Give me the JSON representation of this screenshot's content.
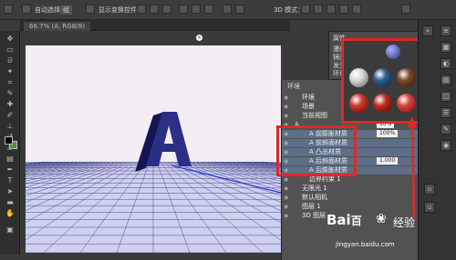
{
  "options_bar": {
    "auto_select_label": "自动选择：",
    "auto_select_value": "组",
    "transform_label": "显示变换控件",
    "mode_3d_label": "3D 模式："
  },
  "document": {
    "tab_label": "66.7% (A, RGB/8)",
    "letter": "A"
  },
  "properties_panel": {
    "tab_title": "属性",
    "rows": [
      "漫射：",
      "镜面：",
      "发光：",
      "环境："
    ]
  },
  "layers_panel": {
    "header_tab": "环境",
    "rows": [
      {
        "label": "环境",
        "indent": 1
      },
      {
        "label": "场景",
        "indent": 1
      },
      {
        "label": "当前视图",
        "indent": 1
      },
      {
        "label": "A",
        "indent": 0,
        "value": "10%"
      },
      {
        "label": "A 前膨胀材质",
        "indent": 2,
        "value": "100%"
      },
      {
        "label": "A 前斜面材质",
        "indent": 2
      },
      {
        "label": "A 凸出材质",
        "indent": 2
      },
      {
        "label": "A 后斜面材质",
        "indent": 2,
        "value": "1.000"
      },
      {
        "label": "A 后膨胀材质",
        "indent": 2
      },
      {
        "label": "边界约束 1",
        "indent": 2
      },
      {
        "label": "无限光 1",
        "indent": 1
      },
      {
        "label": "默认相机",
        "indent": 1
      },
      {
        "label": "图层 1",
        "indent": 1
      },
      {
        "label": "3D 图层",
        "indent": 1
      }
    ]
  },
  "material_picker": {
    "materials": [
      {
        "name": "chrome",
        "color": "#d9d9d9",
        "shade": "#5a5a5a"
      },
      {
        "name": "blue-glass",
        "color": "#2f5e8c",
        "shade": "#0b1f33"
      },
      {
        "name": "wood",
        "color": "#7a4b2a",
        "shade": "#2a150b"
      },
      {
        "name": "red-plaid",
        "color": "#d03a2a",
        "shade": "#5a0c08"
      },
      {
        "name": "red-check",
        "color": "#c02a1e",
        "shade": "#4a0805"
      },
      {
        "name": "red-fabric",
        "color": "#d9443a",
        "shade": "#60120c"
      }
    ]
  },
  "colors": {
    "accent_red": "#e12828",
    "letter_blue": "#2c2f86",
    "letter_blue_dark": "#141651",
    "grid_line": "#4a4d8e",
    "selection": "#5d6e86"
  },
  "watermark": {
    "brand_prefix": "Bai",
    "brand_suffix": "百",
    "brand_cn": "经验",
    "url": "jingyan.baidu.com"
  }
}
